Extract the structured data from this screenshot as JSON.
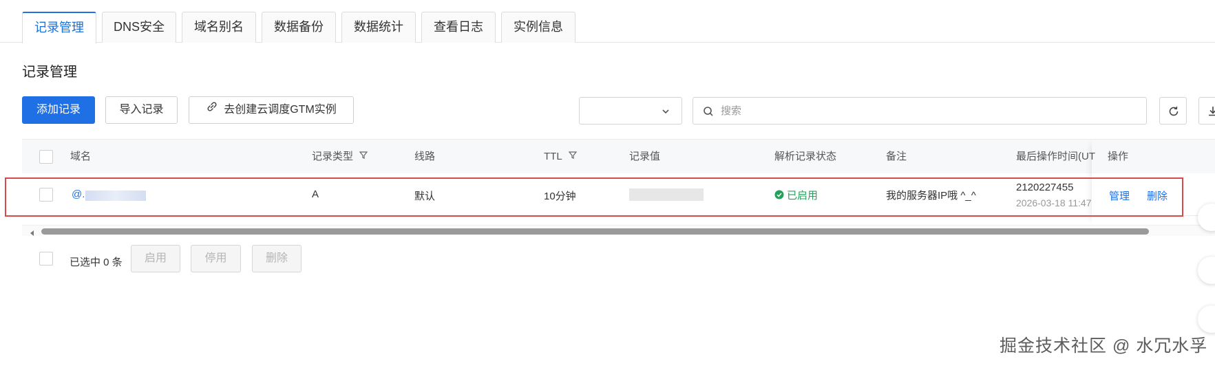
{
  "tabs": [
    {
      "label": "记录管理",
      "active": true
    },
    {
      "label": "DNS安全"
    },
    {
      "label": "域名别名"
    },
    {
      "label": "数据备份"
    },
    {
      "label": "数据统计"
    },
    {
      "label": "查看日志"
    },
    {
      "label": "实例信息"
    }
  ],
  "section_title": "记录管理",
  "toolbar": {
    "add_label": "添加记录",
    "import_label": "导入记录",
    "gtm_label": "去创建云调度GTM实例",
    "select_value": "",
    "search_placeholder": "搜索"
  },
  "table": {
    "headers": {
      "domain": "域名",
      "type": "记录类型",
      "line": "线路",
      "ttl": "TTL",
      "value": "记录值",
      "status": "解析记录状态",
      "remark": "备注",
      "last_op": "最后操作时间(UT",
      "ops": "操作"
    },
    "rows": [
      {
        "domain": "@.",
        "type": "A",
        "line": "默认",
        "ttl": "10分钟",
        "status": "已启用",
        "remark": "我的服务器IP哦 ^_^",
        "last_op_id": "2120227455",
        "last_op_time": "2026-03-18 11:47",
        "manage": "管理",
        "delete": "删除"
      }
    ]
  },
  "footer": {
    "selected_label": "已选中 0 条",
    "enable_label": "启用",
    "disable_label": "停用",
    "delete_label": "删除"
  },
  "watermark": "掘金技术社区 @ 水冗水孚",
  "colors": {
    "primary": "#1f6fe5",
    "status_green": "#23a05a",
    "highlight_red": "#d9494a"
  }
}
